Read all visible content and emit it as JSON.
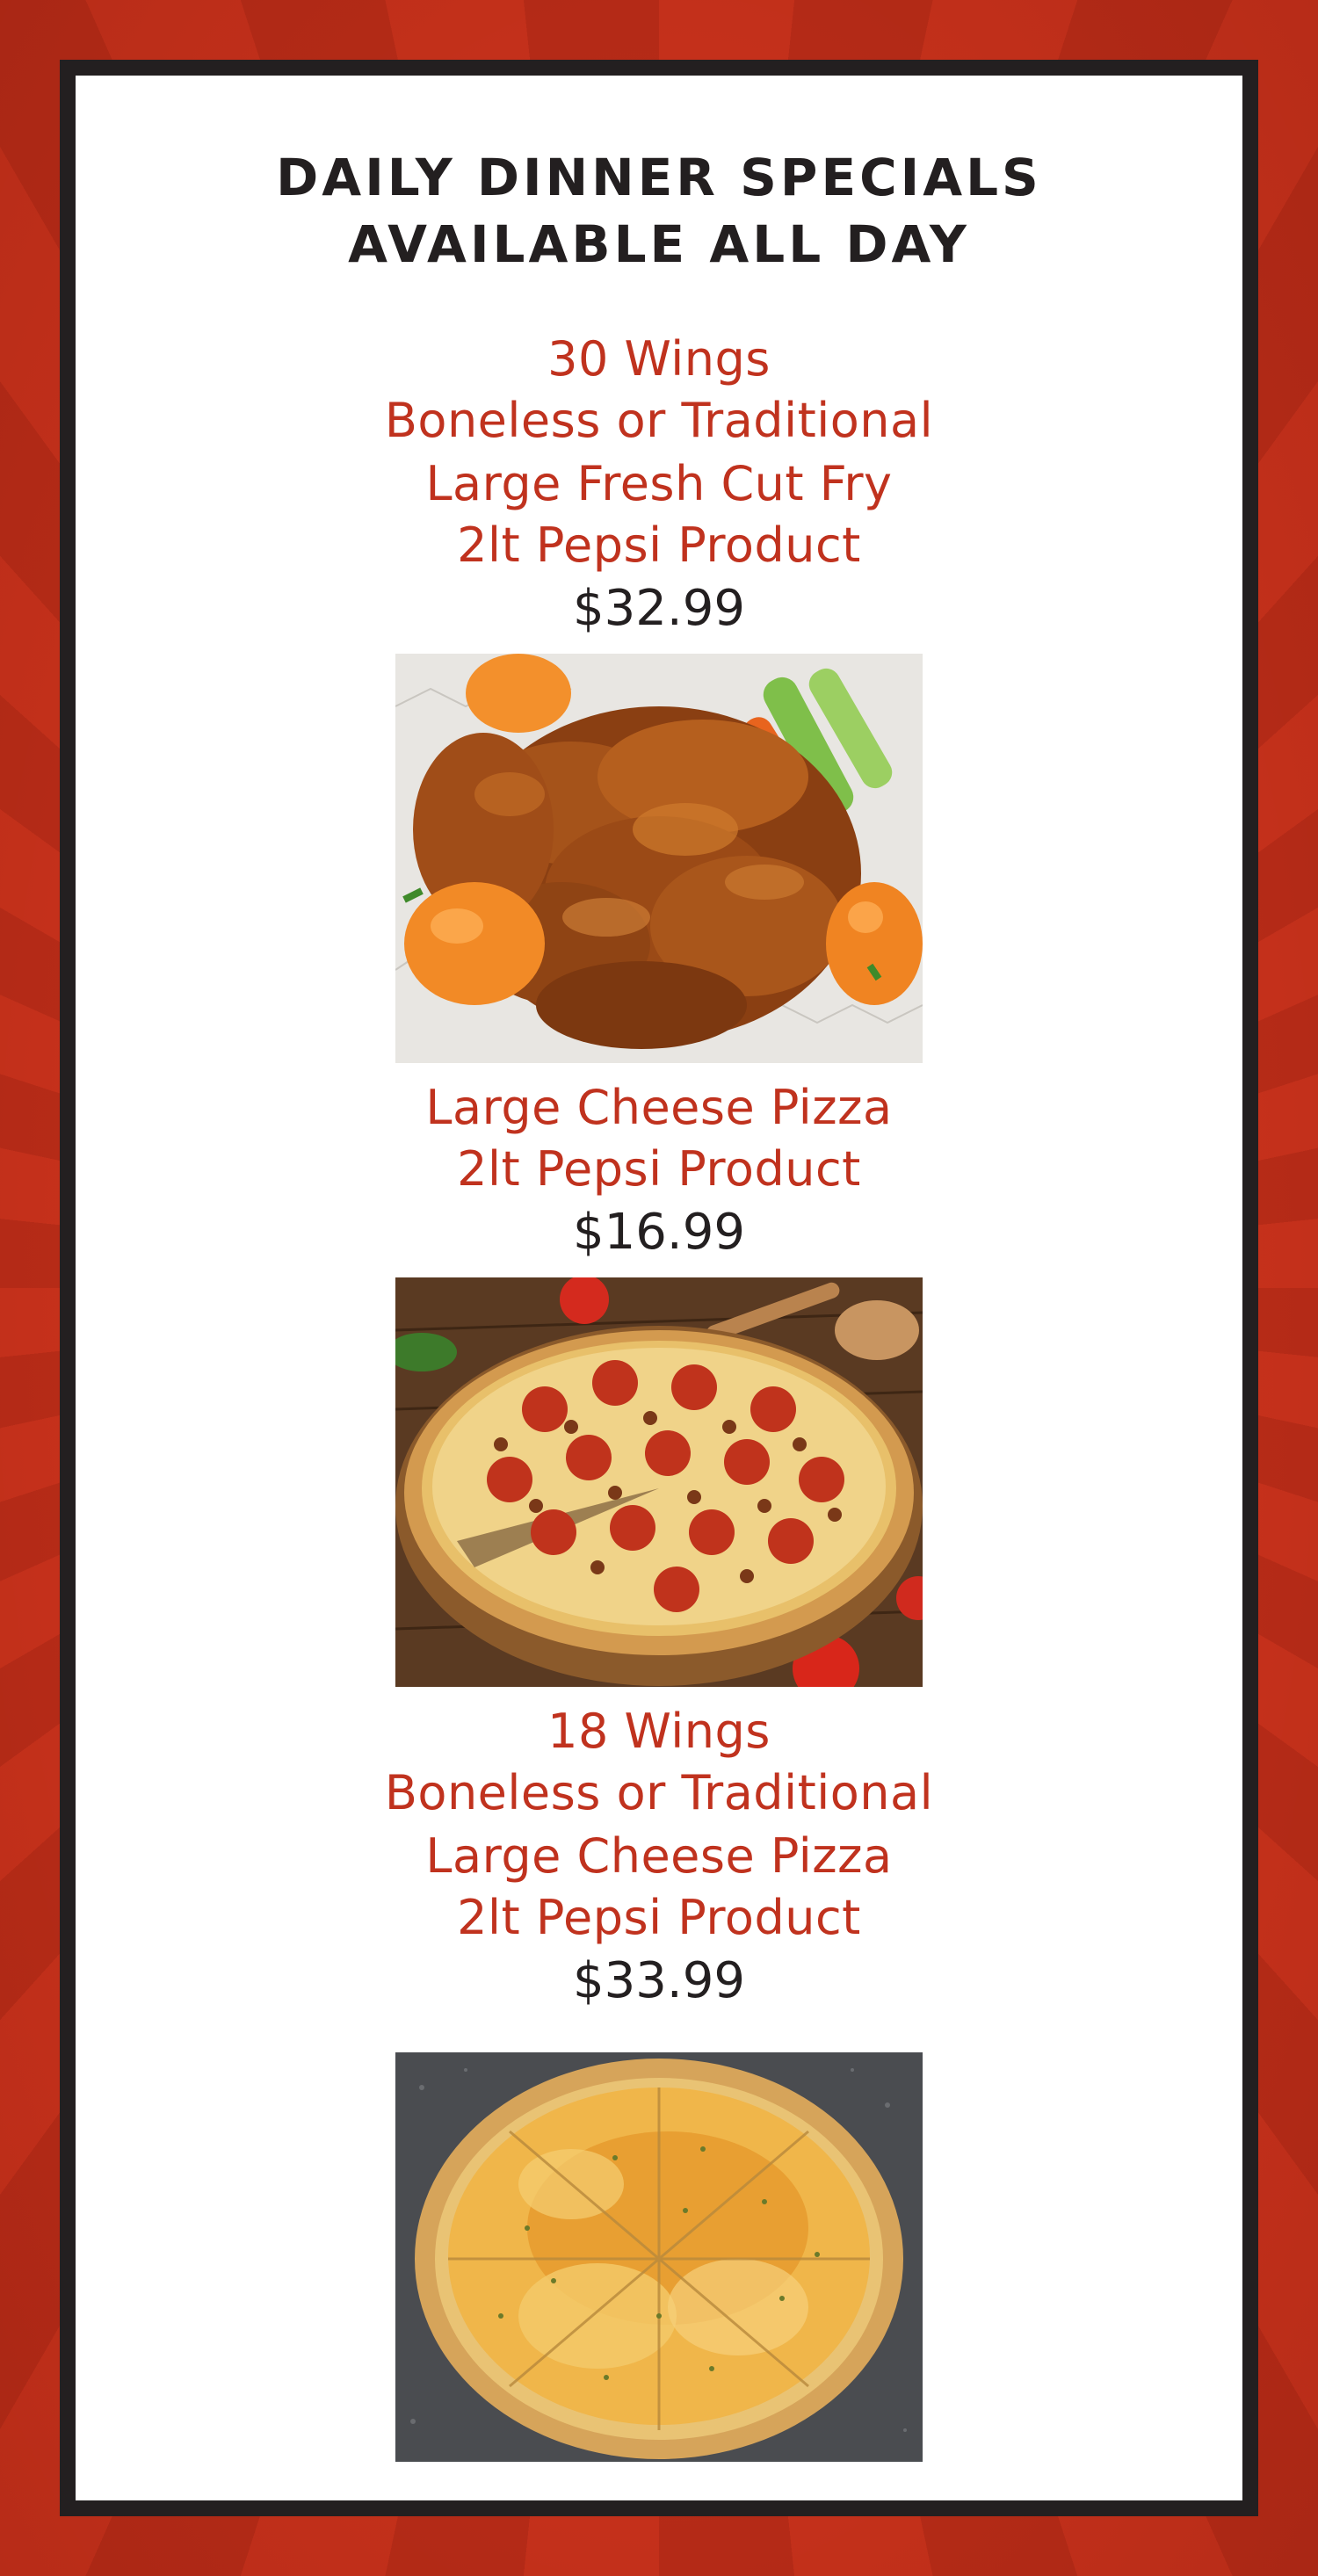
{
  "header": {
    "title_line1": "DAILY DINNER SPECIALS",
    "title_line2": "AVAILABLE ALL DAY"
  },
  "colors": {
    "background": "#c8311b",
    "border": "#231f20",
    "item_text": "#c0321e",
    "price_text": "#231f20"
  },
  "specials": [
    {
      "lines": [
        "30 Wings",
        "Boneless or Traditional",
        "Large Fresh Cut Fry",
        "2lt Pepsi Product"
      ],
      "price": "$32.99",
      "photo": "chicken-wings-photo"
    },
    {
      "lines": [
        "Large Cheese Pizza",
        "2lt Pepsi Product"
      ],
      "price": "$16.99",
      "photo": "pepperoni-pizza-photo"
    },
    {
      "lines": [
        "18 Wings",
        "Boneless or Traditional",
        "Large Cheese Pizza",
        "2lt Pepsi Product"
      ],
      "price": "$33.99",
      "photo": "cheese-pizza-photo"
    }
  ]
}
